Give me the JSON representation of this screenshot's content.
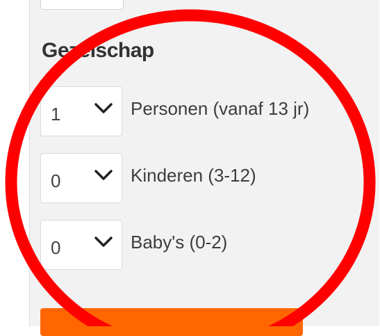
{
  "gezelschap": {
    "title": "Gezelschap",
    "rows": [
      {
        "value": "1",
        "label": "Personen (vanaf 13 jr)"
      },
      {
        "value": "0",
        "label": "Kinderen (3-12)"
      },
      {
        "value": "0",
        "label": "Baby's (0-2)"
      }
    ]
  },
  "icons": {
    "dropdown": "chevron-down-icon"
  },
  "colors": {
    "accent": "#ff6600",
    "annotation": "#ff0000",
    "panel": "#f2f2f2"
  }
}
